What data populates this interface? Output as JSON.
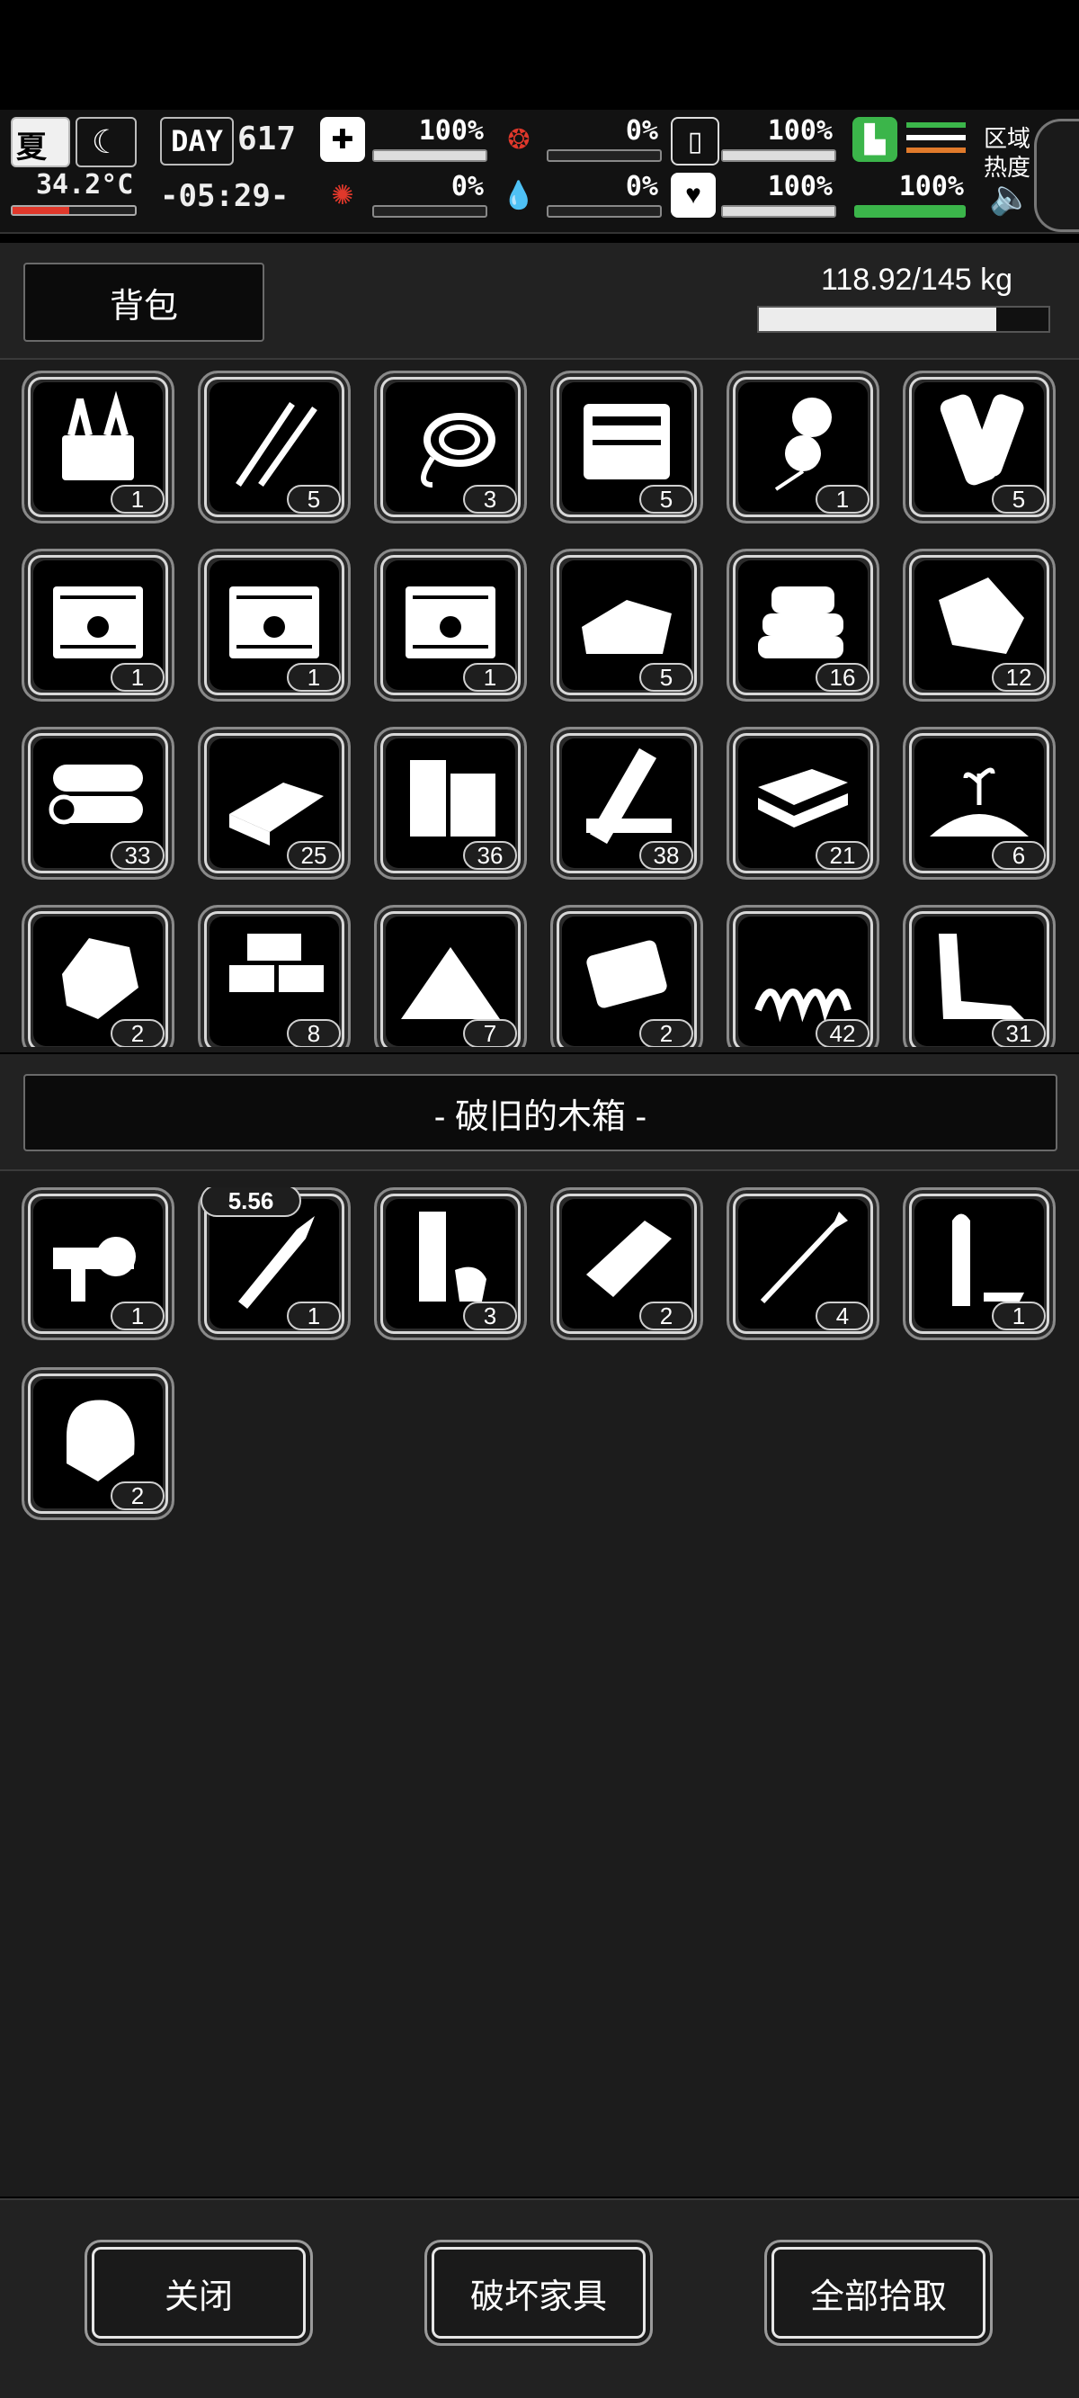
{
  "hud": {
    "season": "夏",
    "temperature": "34.2°C",
    "day_label": "DAY",
    "day_number": "617",
    "time": "-05:29-",
    "health_pct": "100%",
    "hunger_pct": "0%",
    "fatigue_pct": "100%",
    "mental_pct": "0%",
    "bleeding_pct": "0%",
    "mood_pct": "100%",
    "stamina_pct": "100%",
    "area_heat_label_1": "区域",
    "area_heat_label_2": "热度",
    "accent_red": "#e0382b",
    "accent_green": "#3bb54a",
    "accent_orange": "#e07a2b"
  },
  "backpack": {
    "title": "背包",
    "weight": "118.92/145 kg",
    "weight_fraction": 0.82,
    "items": [
      {
        "icon": "toolbox-icon",
        "count": "1"
      },
      {
        "icon": "lockpick-icon",
        "count": "5"
      },
      {
        "icon": "rope-icon",
        "count": "3"
      },
      {
        "icon": "tool-kit-icon",
        "count": "5"
      },
      {
        "icon": "balloon-icon",
        "count": "1"
      },
      {
        "icon": "scroll-icon",
        "count": "5"
      },
      {
        "icon": "crate-icon",
        "count": "1"
      },
      {
        "icon": "crate-icon",
        "count": "1"
      },
      {
        "icon": "crate-icon",
        "count": "1"
      },
      {
        "icon": "cloth-icon",
        "count": "5"
      },
      {
        "icon": "towel-icon",
        "count": "16"
      },
      {
        "icon": "leather-icon",
        "count": "12"
      },
      {
        "icon": "logs-icon",
        "count": "33"
      },
      {
        "icon": "plank-icon",
        "count": "25"
      },
      {
        "icon": "wood-block-icon",
        "count": "36"
      },
      {
        "icon": "boards-icon",
        "count": "38"
      },
      {
        "icon": "stone-slab-icon",
        "count": "21"
      },
      {
        "icon": "soil-sprout-icon",
        "count": "6"
      },
      {
        "icon": "ore-icon",
        "count": "2"
      },
      {
        "icon": "bricks-icon",
        "count": "8"
      },
      {
        "icon": "sand-pile-icon",
        "count": "7"
      },
      {
        "icon": "concrete-icon",
        "count": "2"
      },
      {
        "icon": "spring-icon",
        "count": "42"
      },
      {
        "icon": "scrap-metal-icon",
        "count": "31"
      }
    ]
  },
  "container": {
    "title": "- 破旧的木箱 -",
    "items": [
      {
        "icon": "grenade-launcher-icon",
        "count": "1",
        "caliber": ""
      },
      {
        "icon": "rifle-bullet-icon",
        "count": "1",
        "caliber": "5.56"
      },
      {
        "icon": "shotgun-shell-icon",
        "count": "3",
        "caliber": ""
      },
      {
        "icon": "shell-casing-icon",
        "count": "2",
        "caliber": ""
      },
      {
        "icon": "arrow-icon",
        "count": "4",
        "caliber": ""
      },
      {
        "icon": "bullet-icon",
        "count": "1",
        "caliber": ""
      },
      {
        "icon": "bullet-tip-icon",
        "count": "2",
        "caliber": ""
      }
    ]
  },
  "buttons": {
    "close": "关闭",
    "destroy_furniture": "破坏家具",
    "take_all": "全部拾取"
  }
}
